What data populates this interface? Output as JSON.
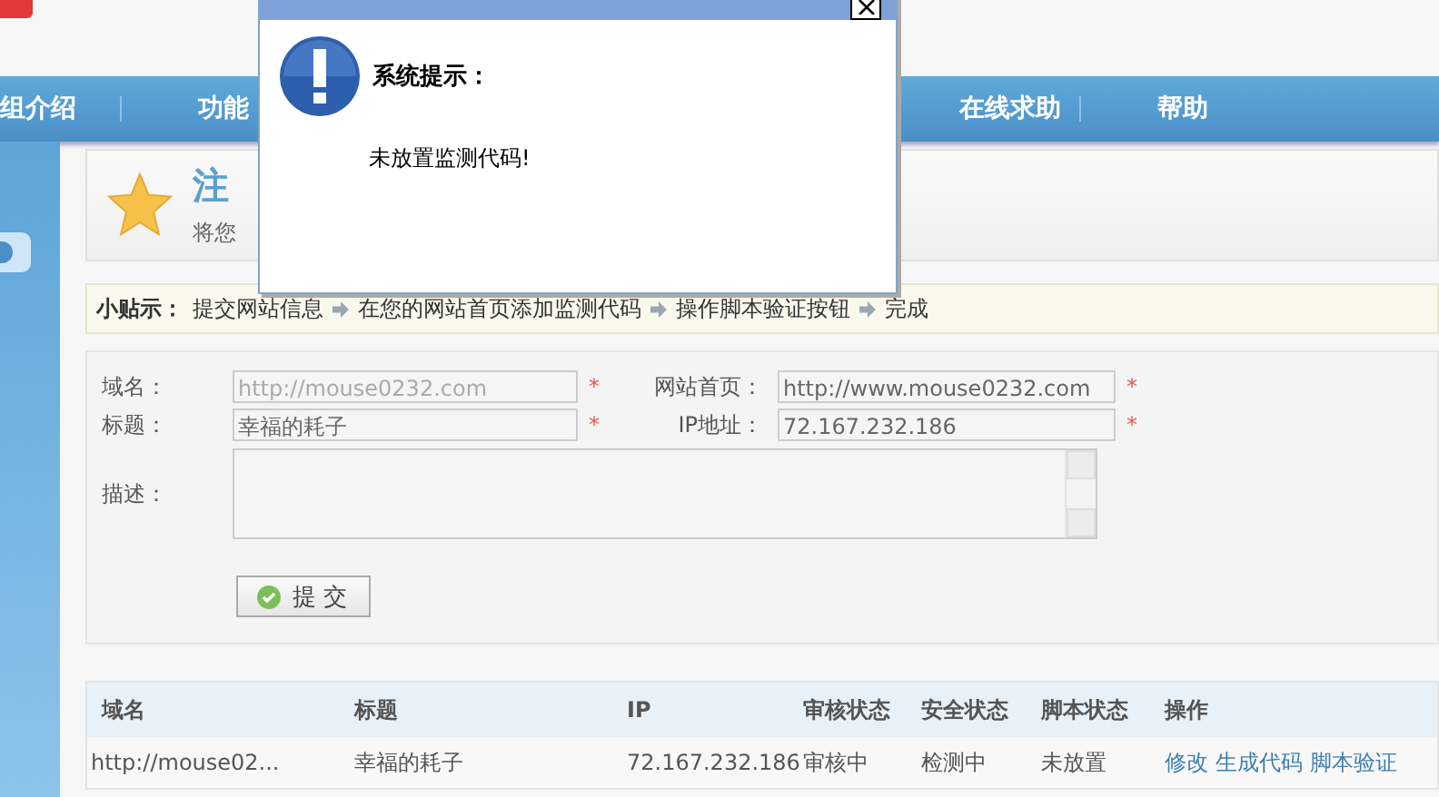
{
  "nav": {
    "items": [
      {
        "label": "组介绍"
      },
      {
        "label": "功能"
      },
      {
        "label": "在线求助"
      },
      {
        "label": "帮助"
      }
    ]
  },
  "intro": {
    "title": "注",
    "subtitle": "将您"
  },
  "tips": {
    "label": "小贴示：",
    "steps": [
      "提交网站信息",
      "在您的网站首页添加监测代码",
      "操作脚本验证按钮",
      "完成"
    ]
  },
  "form": {
    "fields": [
      {
        "label": "域名：",
        "value": "http://mouse0232.com",
        "required": true,
        "disabled": true
      },
      {
        "label": "网站首页：",
        "value": "http://www.mouse0232.com",
        "required": true,
        "disabled": false
      },
      {
        "label": "标题：",
        "value": "幸福的耗子",
        "required": true,
        "disabled": false
      },
      {
        "label": "IP地址：",
        "value": "72.167.232.186",
        "required": true,
        "disabled": false
      }
    ],
    "required_mark": "*",
    "description_label": "描述：",
    "submit": "提 交"
  },
  "table": {
    "columns": [
      "域名",
      "标题",
      "IP",
      "审核状态",
      "安全状态",
      "脚本状态",
      "操作"
    ],
    "rows": [
      {
        "cells": [
          "http://mouse02...",
          "幸福的耗子",
          "72.167.232.186",
          "审核中",
          "检测中",
          "未放置"
        ],
        "actions": [
          "修改",
          "生成代码",
          "脚本验证"
        ]
      }
    ]
  },
  "dialog": {
    "heading": "系统提示：",
    "message": "未放置监测代码!"
  }
}
